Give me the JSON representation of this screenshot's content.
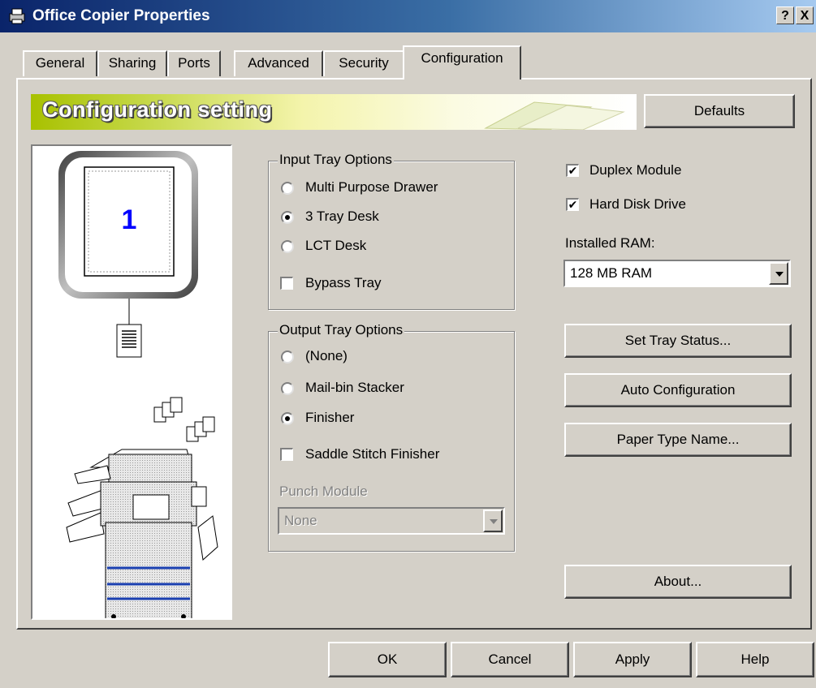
{
  "window": {
    "title": "Office Copier Properties",
    "help_btn": "?",
    "close_btn": "X"
  },
  "tabs": [
    {
      "label": "General"
    },
    {
      "label": "Sharing"
    },
    {
      "label": "Ports"
    },
    {
      "label": "Advanced"
    },
    {
      "label": "Security"
    },
    {
      "label": "Configuration",
      "active": true
    }
  ],
  "banner": {
    "title": "Configuration setting",
    "defaults_label": "Defaults"
  },
  "preview": {
    "page_number": "1"
  },
  "input_tray": {
    "legend": "Input Tray Options",
    "options": [
      {
        "label": "Multi Purpose Drawer",
        "selected": false
      },
      {
        "label": "3 Tray Desk",
        "selected": true
      },
      {
        "label": "LCT Desk",
        "selected": false
      }
    ],
    "bypass_label": "Bypass Tray",
    "bypass_checked": false
  },
  "output_tray": {
    "legend": "Output Tray Options",
    "options": [
      {
        "label": "(None)",
        "selected": false
      },
      {
        "label": "Mail-bin Stacker",
        "selected": false
      },
      {
        "label": "Finisher",
        "selected": true
      }
    ],
    "saddle_label": "Saddle Stitch Finisher",
    "saddle_checked": false,
    "punch_label": "Punch Module",
    "punch_value": "None"
  },
  "options": {
    "duplex_label": "Duplex Module",
    "duplex_checked": true,
    "hdd_label": "Hard Disk Drive",
    "hdd_checked": true,
    "ram_label": "Installed RAM:",
    "ram_value": "128 MB RAM"
  },
  "side_buttons": {
    "set_tray": "Set Tray Status...",
    "auto_config": "Auto Configuration",
    "paper_type": "Paper Type Name...",
    "about": "About..."
  },
  "footer": {
    "ok": "OK",
    "cancel": "Cancel",
    "apply": "Apply",
    "help": "Help"
  }
}
